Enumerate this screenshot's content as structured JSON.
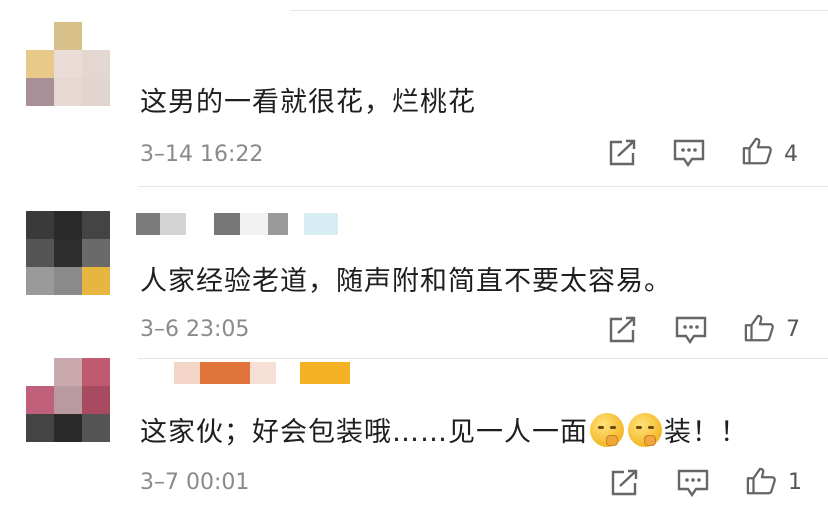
{
  "comments": [
    {
      "text": "这男的一看就很花，烂桃花",
      "timestamp": "3–14 16:22",
      "like_count": "4"
    },
    {
      "text": "人家经验老道，随声附和简直不要太容易。",
      "timestamp": "3–6 23:05",
      "like_count": "7"
    },
    {
      "text_before": "这家伙；好会包装哦……见一人一面",
      "text_after": "装！！",
      "timestamp": "3–7 00:01",
      "like_count": "1"
    }
  ],
  "icons": {
    "share": "share-icon",
    "reply": "comment-icon",
    "like": "thumbs-up-icon",
    "emoji": "shushing-face-emoji"
  }
}
